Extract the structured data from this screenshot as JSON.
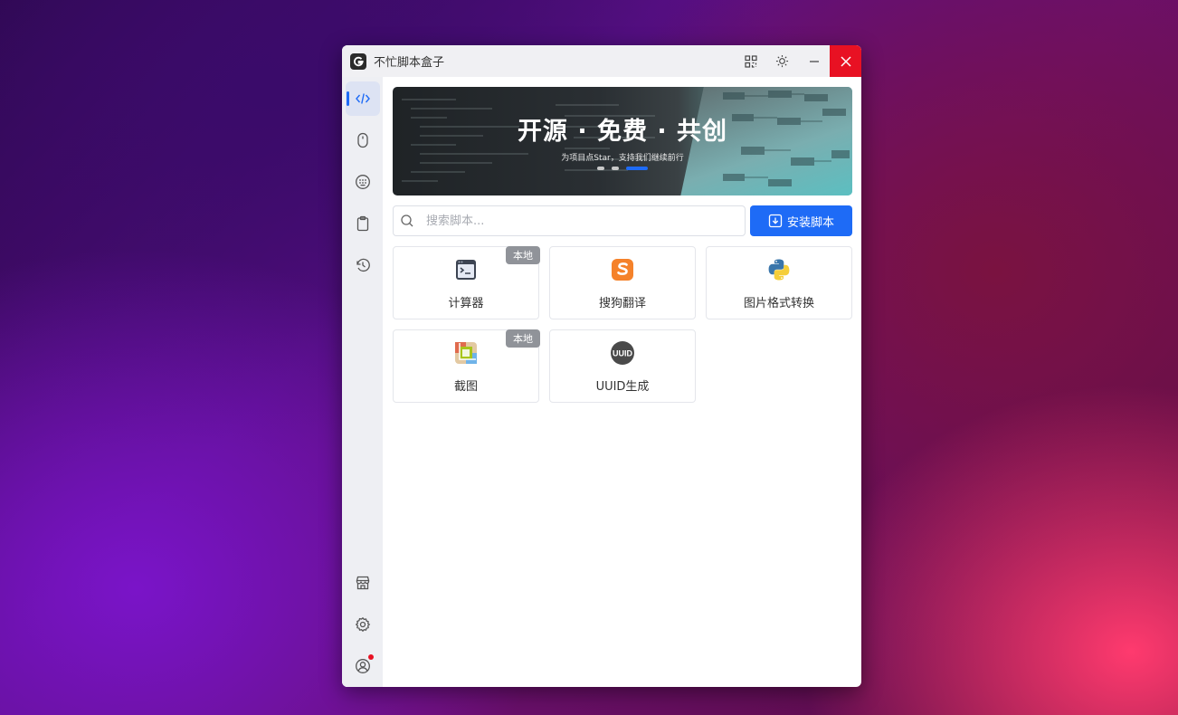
{
  "window": {
    "title": "不忙脚本盒子"
  },
  "banner": {
    "title": "开源 · 免费 · 共创",
    "subtitle": "为项目点Star，支持我们继续前行"
  },
  "search": {
    "placeholder": "搜索脚本..."
  },
  "toolbar": {
    "install_label": "安装脚本"
  },
  "scripts": [
    {
      "name": "计算器",
      "badge": "本地",
      "icon": "terminal-icon"
    },
    {
      "name": "搜狗翻译",
      "badge": "",
      "icon": "sogou-icon"
    },
    {
      "name": "图片格式转换",
      "badge": "",
      "icon": "python-icon"
    },
    {
      "name": "截图",
      "badge": "本地",
      "icon": "screenshot-icon"
    },
    {
      "name": "UUID生成",
      "badge": "",
      "icon": "uuid-icon"
    }
  ],
  "uuid_icon_text": "UUID",
  "colors": {
    "accent": "#1e6bf6",
    "close": "#e81123",
    "badge": "#909399"
  }
}
